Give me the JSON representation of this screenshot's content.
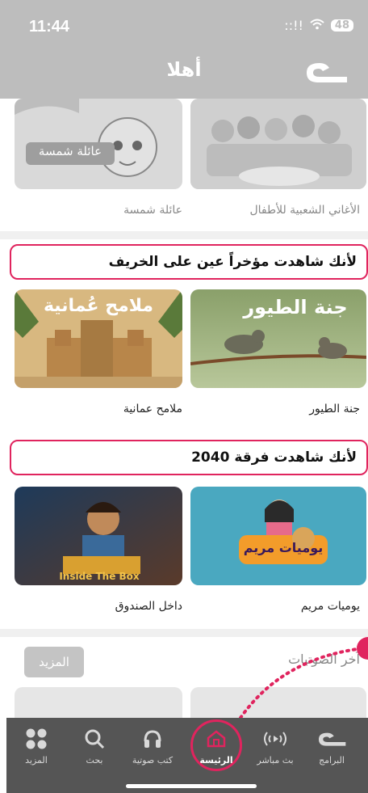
{
  "status": {
    "time": "11:44",
    "battery": "48",
    "signal": "::!!"
  },
  "header": {
    "title": "أهلا"
  },
  "row1": {
    "items": [
      {
        "label": "الأغاني الشعبية للأطفال"
      },
      {
        "label": "عائلة شمسة",
        "overlay": "عائلة شمسة"
      }
    ]
  },
  "section1": {
    "title": "لأنك شاهدت مؤخراً عين على الخريف",
    "items": [
      {
        "label": "جنة الطيور",
        "overlay": "جنة الطيور"
      },
      {
        "label": "ملامح عمانية",
        "overlay": "ملامح عُمانية"
      }
    ]
  },
  "section2": {
    "title": "لأنك شاهدت فرقة 2040",
    "items": [
      {
        "label": "يوميات مريم",
        "overlay": "يوميات مريم"
      },
      {
        "label": "داخل الصندوق",
        "overlay": "Inside The Box"
      }
    ]
  },
  "audio": {
    "title": "آخر الصوتيات",
    "more_label": "المزيد"
  },
  "nav": {
    "items": [
      {
        "label": "البرامج",
        "icon": "programs-icon"
      },
      {
        "label": "بث مباشر",
        "icon": "live-icon"
      },
      {
        "label": "الرئيسة",
        "icon": "home-icon",
        "active": true
      },
      {
        "label": "كتب صوتية",
        "icon": "headphones-icon"
      },
      {
        "label": "بحث",
        "icon": "search-icon"
      },
      {
        "label": "المزيد",
        "icon": "more-icon"
      }
    ]
  },
  "colors": {
    "accent": "#e0245e",
    "header": "#bdbdbd",
    "nav": "#555555"
  }
}
